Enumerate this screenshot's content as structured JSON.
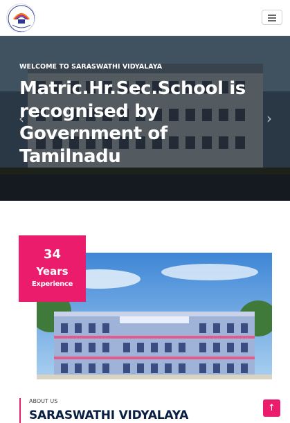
{
  "header": {
    "logo_icon": "school-logo-icon",
    "menu_icon": "hamburger-icon"
  },
  "hero": {
    "eyebrow": "WELCOME TO SARASWATHI VIDYALAYA",
    "title": "Matric.Hr.Sec.School is recognised by Government of Tamilnadu",
    "prev_icon": "chevron-left-icon",
    "next_icon": "chevron-right-icon",
    "prev_glyph": "‹",
    "next_glyph": "›"
  },
  "experience": {
    "number": "34",
    "unit": "Years",
    "label": "Experience"
  },
  "about": {
    "label": "ABOUT US",
    "title": "SARASWATHI VIDYALAYA"
  },
  "back_to_top": {
    "icon": "arrow-up-icon",
    "glyph": "↑"
  },
  "colors": {
    "accent": "#ec1c6d",
    "title_navy": "#0a1f44",
    "header_bg": "#ffffff"
  }
}
